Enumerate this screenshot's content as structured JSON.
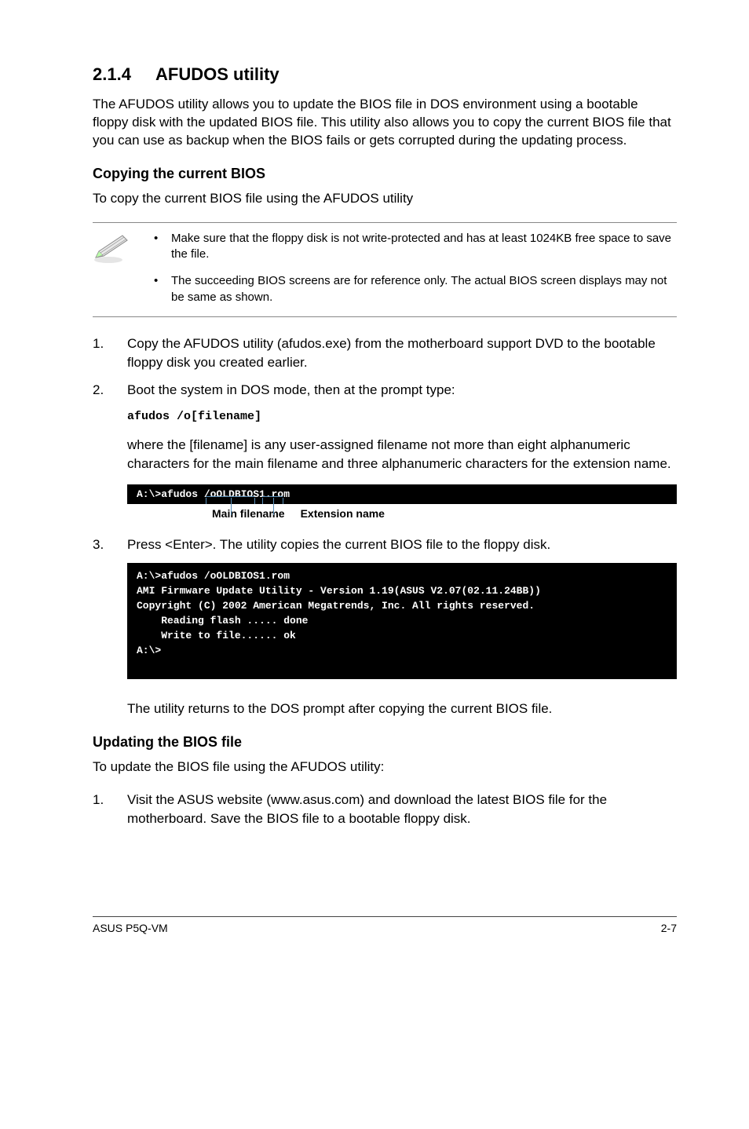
{
  "section": {
    "number": "2.1.4",
    "title": "AFUDOS utility"
  },
  "intro": "The AFUDOS utility allows you to update the BIOS file in DOS environment using a bootable floppy disk with the updated BIOS file. This utility also allows you to copy the current BIOS file that you can use as backup when the BIOS fails or gets corrupted during the updating process.",
  "copy": {
    "heading": "Copying the current BIOS",
    "lead": "To copy the current BIOS file using the AFUDOS utility",
    "notes": [
      "Make sure that the floppy disk is not write-protected and has at least 1024KB free space to save the file.",
      "The succeeding BIOS screens are for reference only. The actual BIOS screen displays may not be same as shown."
    ],
    "steps": [
      "Copy the AFUDOS utility (afudos.exe) from the motherboard support DVD to the bootable floppy disk you created earlier.",
      "Boot the system in DOS mode, then at the prompt type:"
    ],
    "cmd": "afudos /o[filename]",
    "cmd_explain": "where the [filename] is any user-assigned filename not more than eight alphanumeric characters  for the main filename and three alphanumeric characters for the extension name.",
    "term1": "A:\\>afudos /oOLDBIOS1.rom",
    "annot_main": "Main filename",
    "annot_ext": "Extension name",
    "step3": "Press <Enter>. The utility copies the current BIOS file to the floppy disk.",
    "term2": "A:\\>afudos /oOLDBIOS1.rom\nAMI Firmware Update Utility - Version 1.19(ASUS V2.07(02.11.24BB))\nCopyright (C) 2002 American Megatrends, Inc. All rights reserved.\n    Reading flash ..... done\n    Write to file...... ok\nA:\\>\n ",
    "after": "The utility returns to the DOS prompt after copying the current BIOS file."
  },
  "update": {
    "heading": "Updating the BIOS file",
    "lead": "To update the BIOS file using the AFUDOS utility:",
    "step1": "Visit the ASUS website (www.asus.com) and download the latest BIOS file for the motherboard. Save the BIOS file to a bootable floppy disk."
  },
  "footer": {
    "left": "ASUS P5Q-VM",
    "right": "2-7"
  }
}
